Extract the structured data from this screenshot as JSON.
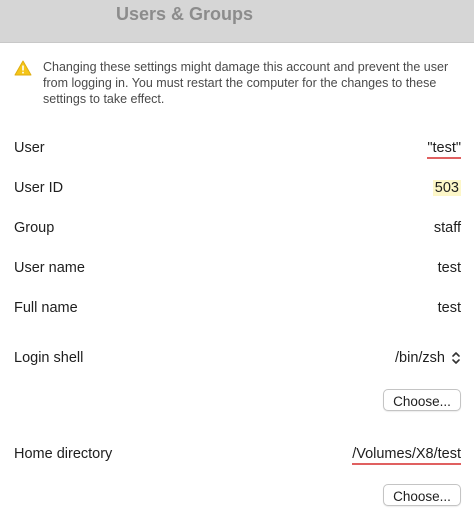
{
  "window": {
    "title": "Users & Groups"
  },
  "warning": {
    "icon": "warning-triangle-icon",
    "text": "Changing these settings might damage this account and prevent the user from logging in. You must restart the computer for the changes to these settings to take effect."
  },
  "fields": {
    "user": {
      "label": "User",
      "value": "\"test\""
    },
    "user_id": {
      "label": "User ID",
      "value": "503"
    },
    "group": {
      "label": "Group",
      "value": "staff"
    },
    "user_name": {
      "label": "User name",
      "value": "test"
    },
    "full_name": {
      "label": "Full name",
      "value": "test"
    },
    "login_shell": {
      "label": "Login shell",
      "value": "/bin/zsh",
      "icon": "chevron-updown-icon"
    },
    "home_directory": {
      "label": "Home directory",
      "value": "/Volumes/X8/test"
    }
  },
  "buttons": {
    "choose_shell": "Choose...",
    "choose_home": "Choose..."
  },
  "colors": {
    "titlebar": "#d6d6d6",
    "warning": "#f5c518",
    "spellcheck_underline": "#e06060",
    "highlight": "#fdf7c8"
  }
}
